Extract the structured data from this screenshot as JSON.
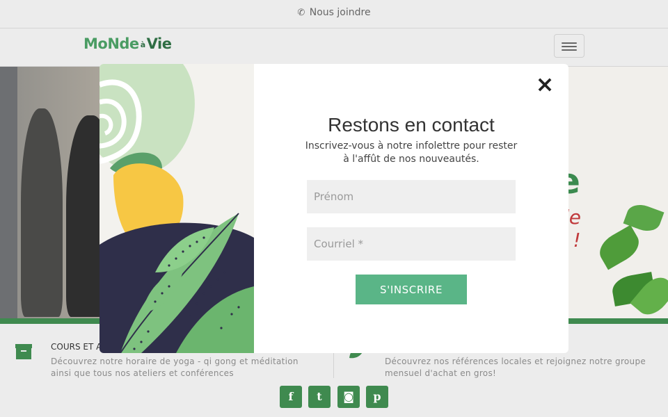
{
  "topbar": {
    "contact_label": "Nous joindre",
    "contact_icon": "phone-icon"
  },
  "navbar": {
    "logo_part1": "MoNde",
    "logo_part2": "à",
    "logo_part3": "Vie",
    "menu_icon": "hamburger-menu-icon"
  },
  "hero": {
    "partial_heading": "e",
    "partial_script": "de",
    "partial_script2": "s !"
  },
  "features": [
    {
      "icon": "archive-box-icon",
      "title": "COURS ET AT",
      "description": "Découvrez notre horaire de yoga - qi gong et méditation ainsi que tous nos ateliers et conférences"
    },
    {
      "icon": "leaf-icon",
      "title": "",
      "description": "Découvrez nos références locales et rejoignez notre groupe mensuel d'achat en gros!"
    }
  ],
  "socials": [
    {
      "icon": "facebook-icon",
      "glyph": "f"
    },
    {
      "icon": "twitter-icon",
      "glyph": "t"
    },
    {
      "icon": "instagram-icon",
      "glyph": "◙"
    },
    {
      "icon": "pinterest-icon",
      "glyph": "p"
    }
  ],
  "modal": {
    "close_label": "×",
    "title": "Restons en contact",
    "subtitle": "Inscrivez-vous à notre infolettre pour rester à l'affût de nos nouveautés.",
    "first_name_placeholder": "Prénom",
    "email_placeholder": "Courriel *",
    "submit_label": "S'INSCRIRE"
  },
  "colors": {
    "brand_green": "#3f8a4f",
    "button_green": "#5ab587",
    "art_navy": "#2f2f4a",
    "art_yellow": "#f7c744",
    "art_pale_green": "#c9e2c1"
  }
}
